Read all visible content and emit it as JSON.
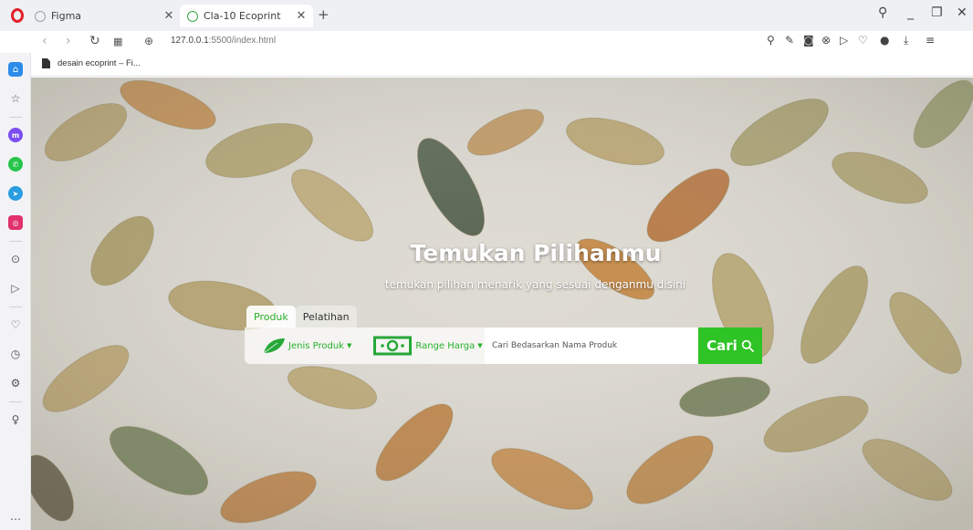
{
  "browser": {
    "tabs": [
      {
        "title": "Figma",
        "active": false
      },
      {
        "title": "Cla-10 Ecoprint",
        "active": true
      }
    ],
    "new_tab": "+",
    "url_host": "127.0.0.1",
    "url_rest": ":5500/index.html",
    "bookmark": "desain ecoprint – Fi..."
  },
  "icons": {
    "sidebar": [
      "home-icon",
      "bookmark-star-icon",
      "messenger-icon",
      "whatsapp-icon",
      "telegram-icon",
      "instagram-icon",
      "player-icon",
      "send-icon",
      "heart-icon",
      "history-icon",
      "settings-icon",
      "lightbulb-icon",
      "more-icon"
    ]
  },
  "colors": {
    "accent_green": "#2ec425",
    "link_green": "#27b02b",
    "opera_red": "#e0212a"
  },
  "hero": {
    "title": "Temukan Pilihanmu",
    "subtitle": "temukan pilihan menarik yang sesuai denganmu disini"
  },
  "search": {
    "tabs": [
      "Produk",
      "Pelatihan"
    ],
    "filter_jenis": "Jenis Produk",
    "filter_range": "Range Harga",
    "placeholder": "Cari Bedasarkan Nama Produk",
    "button": "Cari"
  }
}
